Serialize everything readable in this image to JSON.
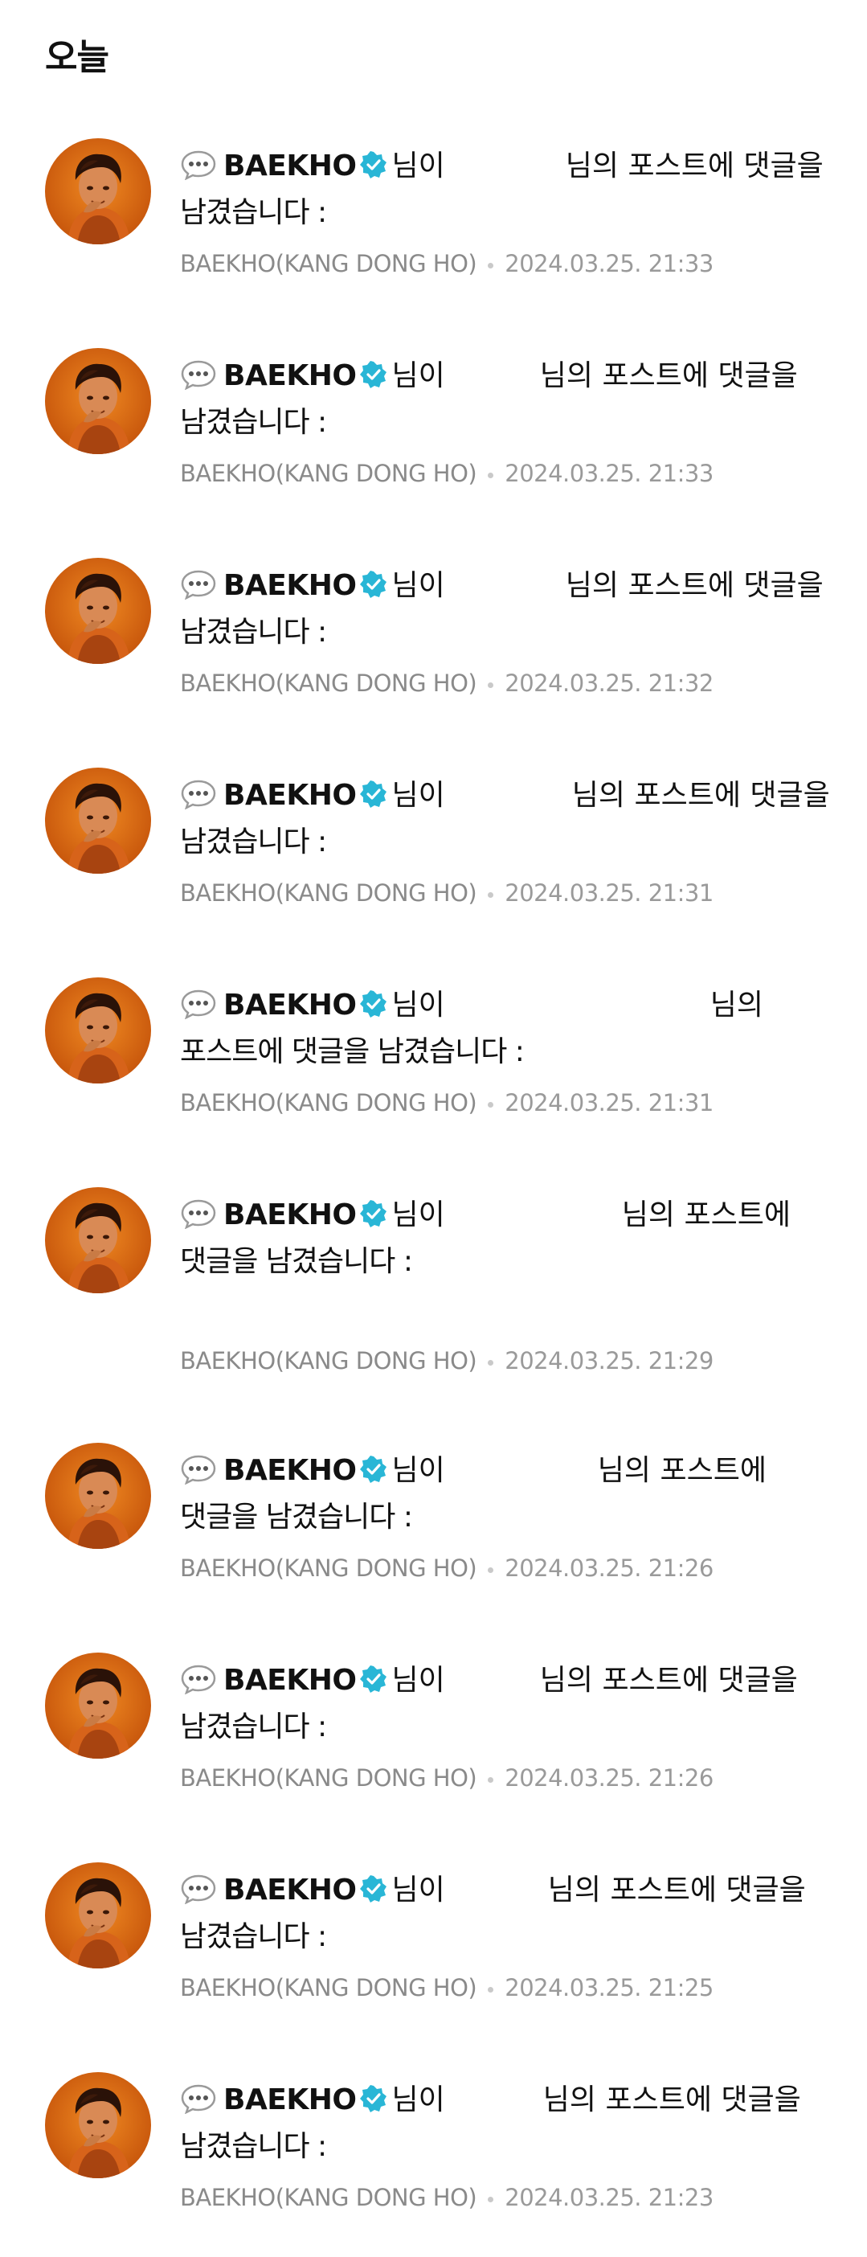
{
  "section_title": "오늘",
  "colors": {
    "verified": "#29b6d6",
    "meta_text": "#8a8a8a",
    "avatar_bg": "#e06a12"
  },
  "icons": {
    "bubble": "comment-bubble-icon",
    "verified": "verified-badge-icon"
  },
  "notifications": [
    {
      "user": "BAEKHO",
      "suffix": "님이",
      "line1_tail": "님의 포스트에 댓글을",
      "line2": "남겼습니다 :",
      "artist": "BAEKHO(KANG DONG HO)",
      "datetime": "2024.03.25. 21:33"
    },
    {
      "user": "BAEKHO",
      "suffix": "님이",
      "line1_tail": "님의 포스트에 댓글을",
      "line2": "남겼습니다 :",
      "artist": "BAEKHO(KANG DONG HO)",
      "datetime": "2024.03.25. 21:33"
    },
    {
      "user": "BAEKHO",
      "suffix": "님이",
      "line1_tail": "님의 포스트에 댓글을",
      "line2": "남겼습니다 :",
      "artist": "BAEKHO(KANG DONG HO)",
      "datetime": "2024.03.25. 21:32"
    },
    {
      "user": "BAEKHO",
      "suffix": "님이",
      "line1_tail": "님의 포스트에 댓글을",
      "line2": "남겼습니다 :",
      "artist": "BAEKHO(KANG DONG HO)",
      "datetime": "2024.03.25. 21:31"
    },
    {
      "user": "BAEKHO",
      "suffix": "님이",
      "line1_tail": "님의",
      "line2": "포스트에 댓글을 남겼습니다 :",
      "artist": "BAEKHO(KANG DONG HO)",
      "datetime": "2024.03.25. 21:31"
    },
    {
      "user": "BAEKHO",
      "suffix": "님이",
      "line1_tail": "님의 포스트에",
      "line2": "댓글을 남겼습니다 :",
      "artist": "BAEKHO(KANG DONG HO)",
      "datetime": "2024.03.25. 21:29"
    },
    {
      "user": "BAEKHO",
      "suffix": "님이",
      "line1_tail": "님의 포스트에",
      "line2": "댓글을 남겼습니다 :",
      "artist": "BAEKHO(KANG DONG HO)",
      "datetime": "2024.03.25. 21:26"
    },
    {
      "user": "BAEKHO",
      "suffix": "님이",
      "line1_tail": "님의 포스트에 댓글을",
      "line2": "남겼습니다 :",
      "artist": "BAEKHO(KANG DONG HO)",
      "datetime": "2024.03.25. 21:26"
    },
    {
      "user": "BAEKHO",
      "suffix": "님이",
      "line1_tail": "님의 포스트에 댓글을",
      "line2": "남겼습니다 :",
      "artist": "BAEKHO(KANG DONG HO)",
      "datetime": "2024.03.25. 21:25"
    },
    {
      "user": "BAEKHO",
      "suffix": "님이",
      "line1_tail": "님의 포스트에 댓글을",
      "line2": "남겼습니다 :",
      "artist": "BAEKHO(KANG DONG HO)",
      "datetime": "2024.03.25. 21:23"
    }
  ]
}
